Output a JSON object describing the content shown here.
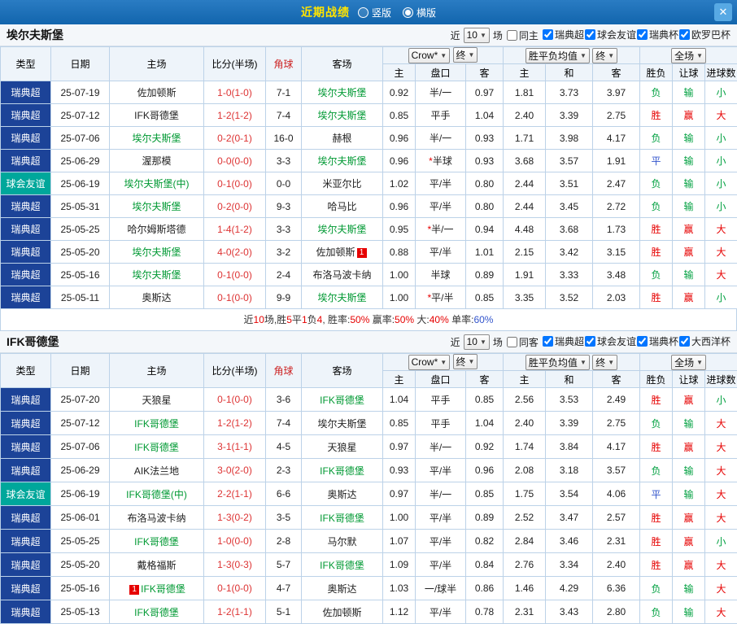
{
  "titlebar": {
    "title": "近期战绩",
    "radios": [
      {
        "label": "竖版",
        "selected": false
      },
      {
        "label": "横版",
        "selected": true
      }
    ],
    "close_glyph": "✕"
  },
  "columns": {
    "type": "类型",
    "date": "日期",
    "home": "主场",
    "score": "比分(半场)",
    "corner": "角球",
    "away": "客场",
    "odds_source": "Crow*",
    "end1": "终",
    "avg": "胜平负均值",
    "end2": "终",
    "scope": "全场",
    "sub": [
      "主",
      "盘口",
      "客",
      "主",
      "和",
      "客",
      "胜负",
      "让球",
      "进球数"
    ]
  },
  "colors": {
    "league_badge": "#1c4398",
    "friendly_badge": "#00a79b",
    "focus_team": "#009933",
    "win": "#e60000",
    "lose": "#00a040",
    "draw": "#3355cc"
  },
  "sections": [
    {
      "team": "埃尔夫斯堡",
      "filters": {
        "near": "近",
        "count": "10",
        "unit": "场",
        "same_label": "同主",
        "same_checked": false,
        "comps": [
          {
            "label": "瑞典超",
            "checked": true
          },
          {
            "label": "球会友谊",
            "checked": true
          },
          {
            "label": "瑞典杯",
            "checked": true
          },
          {
            "label": "欧罗巴杯",
            "checked": true
          }
        ]
      },
      "rows": [
        {
          "type": "瑞典超",
          "cat": "league",
          "date": "25-07-19",
          "home": "佐加顿斯",
          "hg": false,
          "hb": "",
          "score": "1-0(1-0)",
          "corner": "7-1",
          "away": "埃尔夫斯堡",
          "ag": true,
          "ab": "",
          "o1": "0.92",
          "hc": "半/一",
          "o2": "0.97",
          "m1": "1.81",
          "m2": "3.73",
          "m3": "3.97",
          "r1": "负",
          "r2": "输",
          "r3": "小"
        },
        {
          "type": "瑞典超",
          "cat": "league",
          "date": "25-07-12",
          "home": "IFK哥德堡",
          "hg": false,
          "hb": "",
          "score": "1-2(1-2)",
          "corner": "7-4",
          "away": "埃尔夫斯堡",
          "ag": true,
          "ab": "",
          "o1": "0.85",
          "hc": "平手",
          "o2": "1.04",
          "m1": "2.40",
          "m2": "3.39",
          "m3": "2.75",
          "r1": "胜",
          "r2": "赢",
          "r3": "大"
        },
        {
          "type": "瑞典超",
          "cat": "league",
          "date": "25-07-06",
          "home": "埃尔夫斯堡",
          "hg": true,
          "hb": "",
          "score": "0-2(0-1)",
          "corner": "16-0",
          "away": "赫根",
          "ag": false,
          "ab": "",
          "o1": "0.96",
          "hc": "半/一",
          "o2": "0.93",
          "m1": "1.71",
          "m2": "3.98",
          "m3": "4.17",
          "r1": "负",
          "r2": "输",
          "r3": "小"
        },
        {
          "type": "瑞典超",
          "cat": "league",
          "date": "25-06-29",
          "home": "渥那模",
          "hg": false,
          "hb": "",
          "score": "0-0(0-0)",
          "corner": "3-3",
          "away": "埃尔夫斯堡",
          "ag": true,
          "ab": "",
          "o1": "0.96",
          "hc": "*半球",
          "o2": "0.93",
          "m1": "3.68",
          "m2": "3.57",
          "m3": "1.91",
          "r1": "平",
          "r2": "输",
          "r3": "小"
        },
        {
          "type": "球会友谊",
          "cat": "friendly",
          "date": "25-06-19",
          "home": "埃尔夫斯堡(中)",
          "hg": true,
          "hb": "",
          "score": "0-1(0-0)",
          "corner": "0-0",
          "away": "米亚尔比",
          "ag": false,
          "ab": "",
          "o1": "1.02",
          "hc": "平/半",
          "o2": "0.80",
          "m1": "2.44",
          "m2": "3.51",
          "m3": "2.47",
          "r1": "负",
          "r2": "输",
          "r3": "小"
        },
        {
          "type": "瑞典超",
          "cat": "league",
          "date": "25-05-31",
          "home": "埃尔夫斯堡",
          "hg": true,
          "hb": "",
          "score": "0-2(0-0)",
          "corner": "9-3",
          "away": "哈马比",
          "ag": false,
          "ab": "",
          "o1": "0.96",
          "hc": "平/半",
          "o2": "0.80",
          "m1": "2.44",
          "m2": "3.45",
          "m3": "2.72",
          "r1": "负",
          "r2": "输",
          "r3": "小"
        },
        {
          "type": "瑞典超",
          "cat": "league",
          "date": "25-05-25",
          "home": "哈尔姆斯塔德",
          "hg": false,
          "hb": "",
          "score": "1-4(1-2)",
          "corner": "3-3",
          "away": "埃尔夫斯堡",
          "ag": true,
          "ab": "",
          "o1": "0.95",
          "hc": "*半/一",
          "o2": "0.94",
          "m1": "4.48",
          "m2": "3.68",
          "m3": "1.73",
          "r1": "胜",
          "r2": "赢",
          "r3": "大"
        },
        {
          "type": "瑞典超",
          "cat": "league",
          "date": "25-05-20",
          "home": "埃尔夫斯堡",
          "hg": true,
          "hb": "",
          "score": "4-0(2-0)",
          "corner": "3-2",
          "away": "佐加顿斯",
          "ag": false,
          "ab": "1",
          "o1": "0.88",
          "hc": "平/半",
          "o2": "1.01",
          "m1": "2.15",
          "m2": "3.42",
          "m3": "3.15",
          "r1": "胜",
          "r2": "赢",
          "r3": "大"
        },
        {
          "type": "瑞典超",
          "cat": "league",
          "date": "25-05-16",
          "home": "埃尔夫斯堡",
          "hg": true,
          "hb": "",
          "score": "0-1(0-0)",
          "corner": "2-4",
          "away": "布洛马波卡纳",
          "ag": false,
          "ab": "",
          "o1": "1.00",
          "hc": "半球",
          "o2": "0.89",
          "m1": "1.91",
          "m2": "3.33",
          "m3": "3.48",
          "r1": "负",
          "r2": "输",
          "r3": "大"
        },
        {
          "type": "瑞典超",
          "cat": "league",
          "date": "25-05-11",
          "home": "奥斯达",
          "hg": false,
          "hb": "",
          "score": "0-1(0-0)",
          "corner": "9-9",
          "away": "埃尔夫斯堡",
          "ag": true,
          "ab": "",
          "o1": "1.00",
          "hc": "*平/半",
          "o2": "0.85",
          "m1": "3.35",
          "m2": "3.52",
          "m3": "2.03",
          "r1": "胜",
          "r2": "赢",
          "r3": "小"
        }
      ],
      "footer": [
        [
          "近",
          "k"
        ],
        [
          "10",
          "r"
        ],
        [
          "场,胜",
          "k"
        ],
        [
          "5",
          "r"
        ],
        [
          "平",
          "k"
        ],
        [
          "1",
          "r"
        ],
        [
          "负",
          "k"
        ],
        [
          "4",
          "r"
        ],
        [
          ", 胜率:",
          "k"
        ],
        [
          "50%",
          "r"
        ],
        [
          "  赢率:",
          "k"
        ],
        [
          "50%",
          "r"
        ],
        [
          "  大:",
          "k"
        ],
        [
          "40%",
          "r"
        ],
        [
          "  单率:",
          "k"
        ],
        [
          "60%",
          "b"
        ]
      ]
    },
    {
      "team": "IFK哥德堡",
      "filters": {
        "near": "近",
        "count": "10",
        "unit": "场",
        "same_label": "同客",
        "same_checked": false,
        "comps": [
          {
            "label": "瑞典超",
            "checked": true
          },
          {
            "label": "球会友谊",
            "checked": true
          },
          {
            "label": "瑞典杯",
            "checked": true
          },
          {
            "label": "大西洋杯",
            "checked": true
          }
        ]
      },
      "rows": [
        {
          "type": "瑞典超",
          "cat": "league",
          "date": "25-07-20",
          "home": "天狼星",
          "hg": false,
          "hb": "",
          "score": "0-1(0-0)",
          "corner": "3-6",
          "away": "IFK哥德堡",
          "ag": true,
          "ab": "",
          "o1": "1.04",
          "hc": "平手",
          "o2": "0.85",
          "m1": "2.56",
          "m2": "3.53",
          "m3": "2.49",
          "r1": "胜",
          "r2": "赢",
          "r3": "小"
        },
        {
          "type": "瑞典超",
          "cat": "league",
          "date": "25-07-12",
          "home": "IFK哥德堡",
          "hg": true,
          "hb": "",
          "score": "1-2(1-2)",
          "corner": "7-4",
          "away": "埃尔夫斯堡",
          "ag": false,
          "ab": "",
          "o1": "0.85",
          "hc": "平手",
          "o2": "1.04",
          "m1": "2.40",
          "m2": "3.39",
          "m3": "2.75",
          "r1": "负",
          "r2": "输",
          "r3": "大"
        },
        {
          "type": "瑞典超",
          "cat": "league",
          "date": "25-07-06",
          "home": "IFK哥德堡",
          "hg": true,
          "hb": "",
          "score": "3-1(1-1)",
          "corner": "4-5",
          "away": "天狼星",
          "ag": false,
          "ab": "",
          "o1": "0.97",
          "hc": "半/一",
          "o2": "0.92",
          "m1": "1.74",
          "m2": "3.84",
          "m3": "4.17",
          "r1": "胜",
          "r2": "赢",
          "r3": "大"
        },
        {
          "type": "瑞典超",
          "cat": "league",
          "date": "25-06-29",
          "home": "AIK法兰地",
          "hg": false,
          "hb": "",
          "score": "3-0(2-0)",
          "corner": "2-3",
          "away": "IFK哥德堡",
          "ag": true,
          "ab": "",
          "o1": "0.93",
          "hc": "平/半",
          "o2": "0.96",
          "m1": "2.08",
          "m2": "3.18",
          "m3": "3.57",
          "r1": "负",
          "r2": "输",
          "r3": "大"
        },
        {
          "type": "球会友谊",
          "cat": "friendly",
          "date": "25-06-19",
          "home": "IFK哥德堡(中)",
          "hg": true,
          "hb": "",
          "score": "2-2(1-1)",
          "corner": "6-6",
          "away": "奥斯达",
          "ag": false,
          "ab": "",
          "o1": "0.97",
          "hc": "半/一",
          "o2": "0.85",
          "m1": "1.75",
          "m2": "3.54",
          "m3": "4.06",
          "r1": "平",
          "r2": "输",
          "r3": "大"
        },
        {
          "type": "瑞典超",
          "cat": "league",
          "date": "25-06-01",
          "home": "布洛马波卡纳",
          "hg": false,
          "hb": "",
          "score": "1-3(0-2)",
          "corner": "3-5",
          "away": "IFK哥德堡",
          "ag": true,
          "ab": "",
          "o1": "1.00",
          "hc": "平/半",
          "o2": "0.89",
          "m1": "2.52",
          "m2": "3.47",
          "m3": "2.57",
          "r1": "胜",
          "r2": "赢",
          "r3": "大"
        },
        {
          "type": "瑞典超",
          "cat": "league",
          "date": "25-05-25",
          "home": "IFK哥德堡",
          "hg": true,
          "hb": "",
          "score": "1-0(0-0)",
          "corner": "2-8",
          "away": "马尔默",
          "ag": false,
          "ab": "",
          "o1": "1.07",
          "hc": "平/半",
          "o2": "0.82",
          "m1": "2.84",
          "m2": "3.46",
          "m3": "2.31",
          "r1": "胜",
          "r2": "赢",
          "r3": "小"
        },
        {
          "type": "瑞典超",
          "cat": "league",
          "date": "25-05-20",
          "home": "戴格福斯",
          "hg": false,
          "hb": "",
          "score": "1-3(0-3)",
          "corner": "5-7",
          "away": "IFK哥德堡",
          "ag": true,
          "ab": "",
          "o1": "1.09",
          "hc": "平/半",
          "o2": "0.84",
          "m1": "2.76",
          "m2": "3.34",
          "m3": "2.40",
          "r1": "胜",
          "r2": "赢",
          "r3": "大"
        },
        {
          "type": "瑞典超",
          "cat": "league",
          "date": "25-05-16",
          "home": "IFK哥德堡",
          "hg": true,
          "hb": "1",
          "score": "0-1(0-0)",
          "corner": "4-7",
          "away": "奥斯达",
          "ag": false,
          "ab": "",
          "o1": "1.03",
          "hc": "一/球半",
          "o2": "0.86",
          "m1": "1.46",
          "m2": "4.29",
          "m3": "6.36",
          "r1": "负",
          "r2": "输",
          "r3": "大"
        },
        {
          "type": "瑞典超",
          "cat": "league",
          "date": "25-05-13",
          "home": "IFK哥德堡",
          "hg": true,
          "hb": "",
          "score": "1-2(1-1)",
          "corner": "5-1",
          "away": "佐加顿斯",
          "ag": false,
          "ab": "",
          "o1": "1.12",
          "hc": "平/半",
          "o2": "0.78",
          "m1": "2.31",
          "m2": "3.43",
          "m3": "2.80",
          "r1": "负",
          "r2": "输",
          "r3": "大"
        }
      ],
      "footer": []
    }
  ]
}
